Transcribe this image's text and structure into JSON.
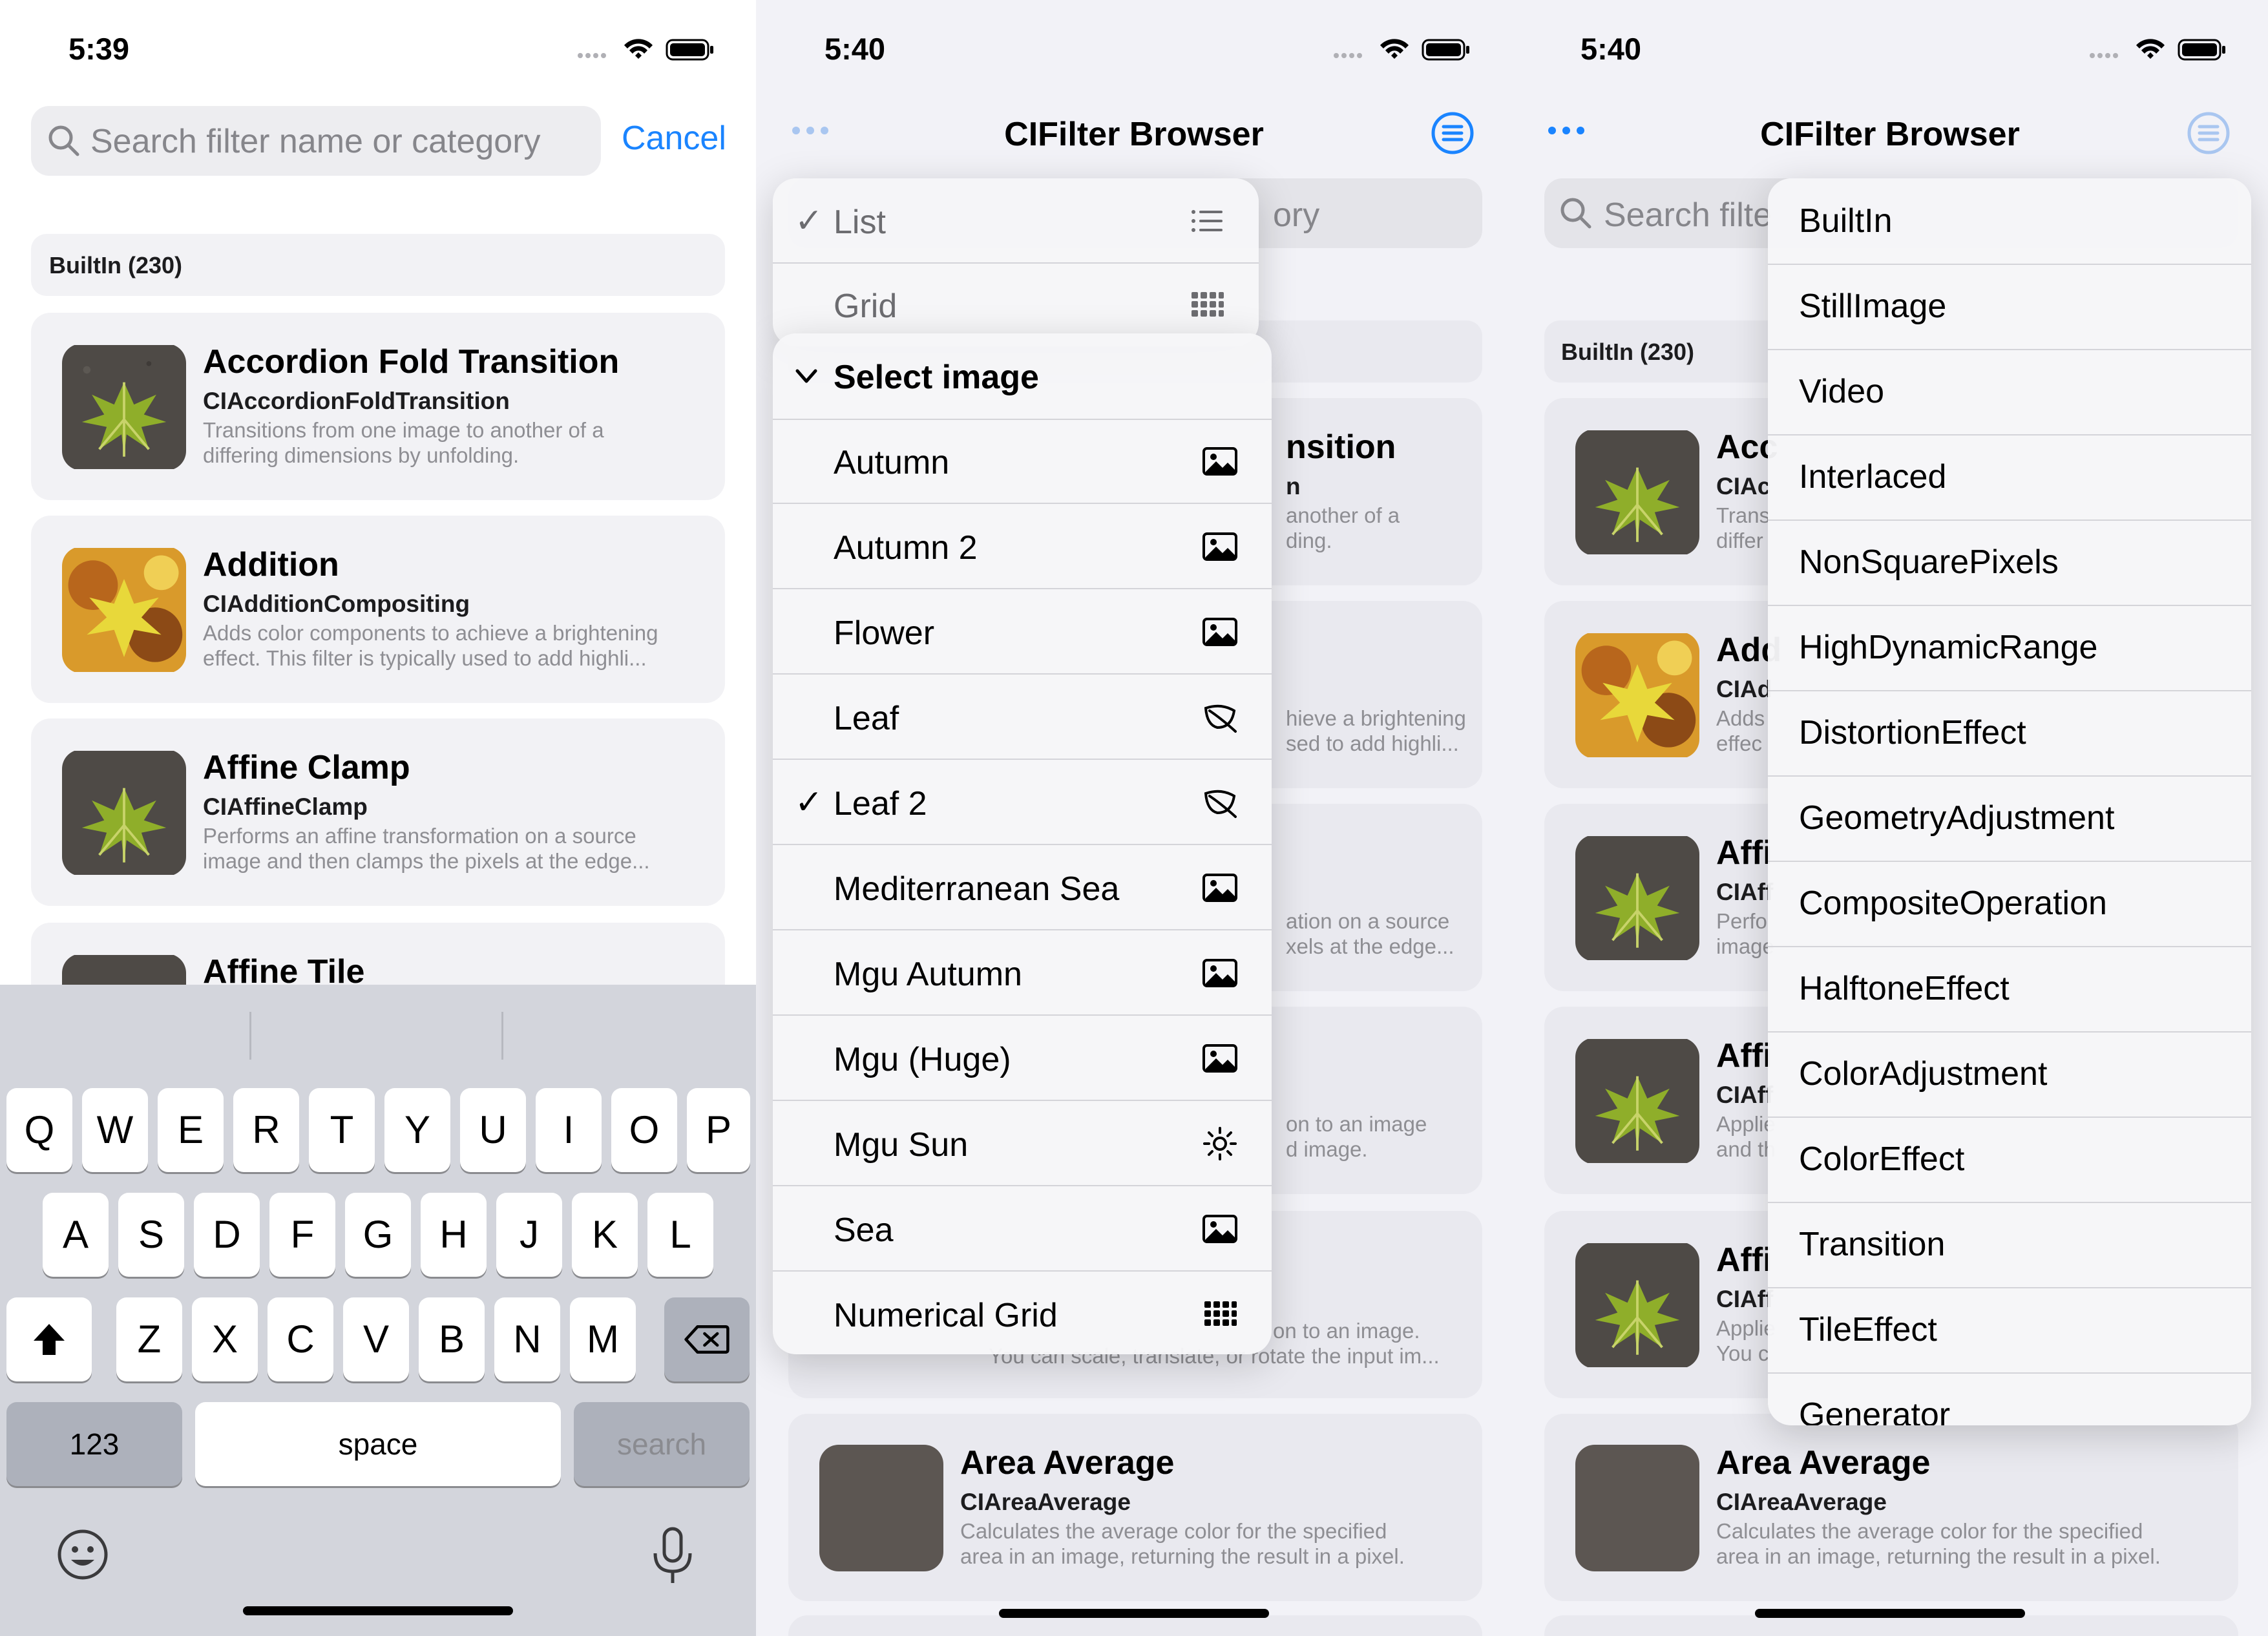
{
  "colors": {
    "accent": "#1a84ff",
    "card_bg": "#f2f2f5",
    "secondary_text": "#8e8e93"
  },
  "screen1": {
    "time": "5:39",
    "search": {
      "placeholder": "Search filter name or category",
      "cancel": "Cancel"
    },
    "section": "BuiltIn (230)",
    "cards": [
      {
        "title": "Accordion Fold Transition",
        "class": "CIAccordionFoldTransition",
        "desc": [
          "Transitions from one image to another of a",
          "differing dimensions by unfolding."
        ],
        "thumb": "leaf"
      },
      {
        "title": "Addition",
        "class": "CIAdditionCompositing",
        "desc": [
          "Adds color components to achieve a brightening",
          "effect. This filter is typically used to add highli..."
        ],
        "thumb": "autumn"
      },
      {
        "title": "Affine Clamp",
        "class": "CIAffineClamp",
        "desc": [
          "Performs an affine transformation on a source",
          "image and then clamps the pixels at the edge..."
        ],
        "thumb": "leaf"
      },
      {
        "title": "Affine Tile",
        "class": "",
        "desc": [],
        "thumb": "leaf"
      }
    ],
    "keyboard": {
      "row1": [
        "Q",
        "W",
        "E",
        "R",
        "T",
        "Y",
        "U",
        "I",
        "O",
        "P"
      ],
      "row2": [
        "A",
        "S",
        "D",
        "F",
        "G",
        "H",
        "J",
        "K",
        "L"
      ],
      "row3": [
        "Z",
        "X",
        "C",
        "V",
        "B",
        "N",
        "M"
      ],
      "numbers": "123",
      "space": "space",
      "search": "search",
      "icons": [
        "shift-icon",
        "delete-icon",
        "emoji-icon",
        "microphone-icon"
      ]
    }
  },
  "screen2": {
    "time": "5:40",
    "title": "CIFilter Browser",
    "search_fragment": "ory",
    "view_menu": [
      {
        "label": "List",
        "checked": true,
        "icon": "list-icon"
      },
      {
        "label": "Grid",
        "checked": false,
        "icon": "grid-icon"
      }
    ],
    "image_menu": {
      "header": "Select image",
      "items": [
        {
          "label": "Autumn",
          "icon": "photo-icon",
          "checked": false
        },
        {
          "label": "Autumn 2",
          "icon": "photo-icon",
          "checked": false
        },
        {
          "label": "Flower",
          "icon": "photo-icon",
          "checked": false
        },
        {
          "label": "Leaf",
          "icon": "leaf-icon",
          "checked": false
        },
        {
          "label": "Leaf 2",
          "icon": "leaf-icon",
          "checked": true
        },
        {
          "label": "Mediterranean Sea",
          "icon": "photo-icon",
          "checked": false
        },
        {
          "label": "Mgu Autumn",
          "icon": "photo-icon",
          "checked": false
        },
        {
          "label": "Mgu (Huge)",
          "icon": "photo-icon",
          "checked": false
        },
        {
          "label": "Mgu Sun",
          "icon": "sun-icon",
          "checked": false
        },
        {
          "label": "Sea",
          "icon": "photo-icon",
          "checked": false
        },
        {
          "label": "Numerical Grid",
          "icon": "grid-icon",
          "checked": false
        }
      ]
    },
    "peek": [
      {
        "title": "nsition",
        "class": "n",
        "desc": [
          "another of a",
          "ding."
        ]
      },
      {
        "desc": [
          "hieve a brightening",
          "sed to add highli..."
        ]
      },
      {
        "desc": [
          "ation on a source",
          "xels at the edge..."
        ]
      },
      {
        "desc": [
          "on to an image",
          "d image."
        ]
      },
      {
        "desc": [
          "on to an image.",
          "You can scale, translate, or rotate the input im..."
        ]
      }
    ],
    "area_card": {
      "title": "Area Average",
      "class": "CIAreaAverage",
      "desc": [
        "Calculates the average color for the specified",
        "area in an image, returning the result in a pixel."
      ]
    }
  },
  "screen3": {
    "time": "5:40",
    "title": "CIFilter Browser",
    "search_fragment": "Search filte",
    "section": "BuiltIn (230)",
    "peek_cards": [
      {
        "title": "Acc",
        "class": "CIAc",
        "desc": [
          "Trans",
          "differ"
        ],
        "thumb": "leaf"
      },
      {
        "title": "Add",
        "class": "CIAd",
        "desc": [
          "Adds",
          "effec"
        ],
        "thumb": "autumn"
      },
      {
        "title": "Affi",
        "class": "CIAff",
        "desc": [
          "Perfo",
          "image"
        ],
        "thumb": "leaf"
      },
      {
        "title": "Affi",
        "class": "CIAff",
        "desc": [
          "Applie",
          "and th"
        ],
        "thumb": "leaf"
      },
      {
        "title": "Affi",
        "class": "CIAff",
        "desc": [
          "Applie",
          "You c"
        ],
        "thumb": "leaf"
      }
    ],
    "area_card": {
      "title": "Area Average",
      "class": "CIAreaAverage",
      "desc": [
        "Calculates the average color for the specified",
        "area in an image, returning the result in a pixel."
      ]
    },
    "categories": [
      "BuiltIn",
      "StillImage",
      "Video",
      "Interlaced",
      "NonSquarePixels",
      "HighDynamicRange",
      "DistortionEffect",
      "GeometryAdjustment",
      "CompositeOperation",
      "HalftoneEffect",
      "ColorAdjustment",
      "ColorEffect",
      "Transition",
      "TileEffect",
      "Generator"
    ]
  }
}
